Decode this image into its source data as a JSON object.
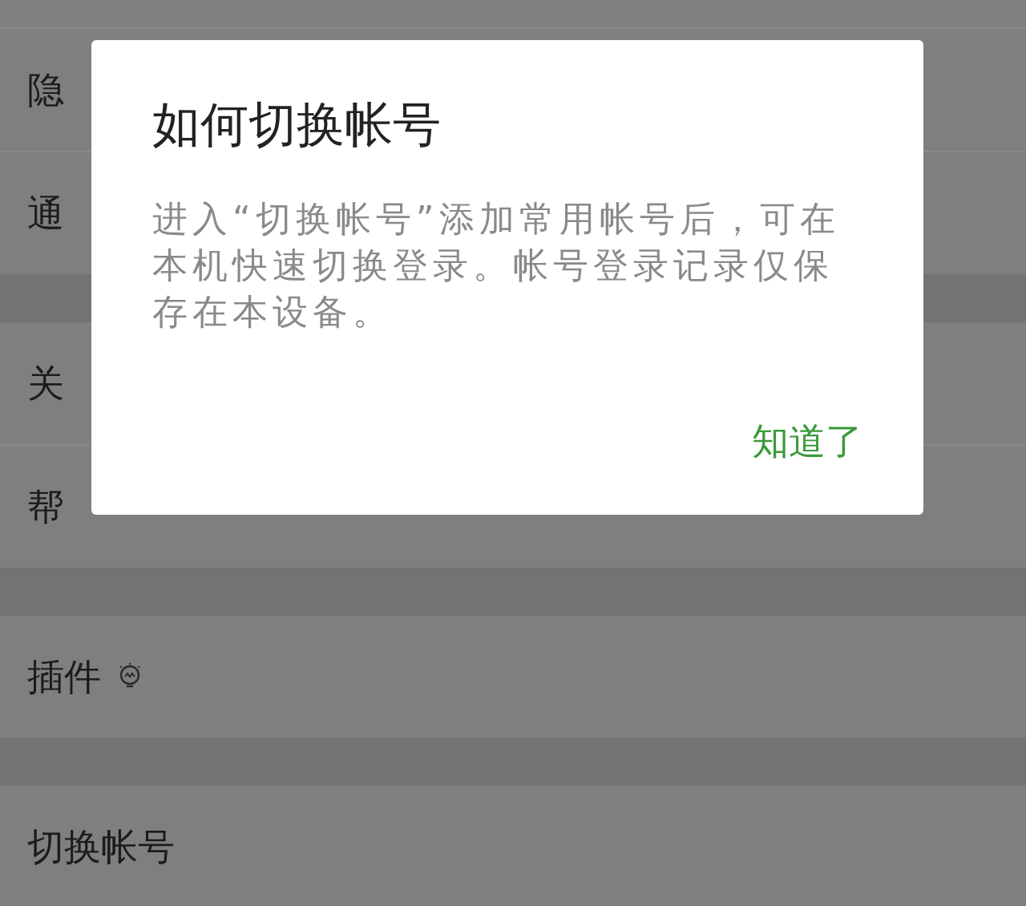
{
  "settings_groups": [
    {
      "rows": [
        {
          "label": "隐"
        },
        {
          "label": "通"
        }
      ]
    },
    {
      "rows": [
        {
          "label": "关"
        },
        {
          "label": "帮"
        }
      ]
    },
    {
      "rows": [
        {
          "label": "插件",
          "has_icon": true
        }
      ]
    },
    {
      "rows": [
        {
          "label": "切换帐号"
        }
      ]
    }
  ],
  "dialog": {
    "title": "如何切换帐号",
    "message": "进入“切换帐号”添加常用帐号后，可在本机快速切换登录。帐号登录记录仅保存在本设备。",
    "button": "知道了"
  }
}
